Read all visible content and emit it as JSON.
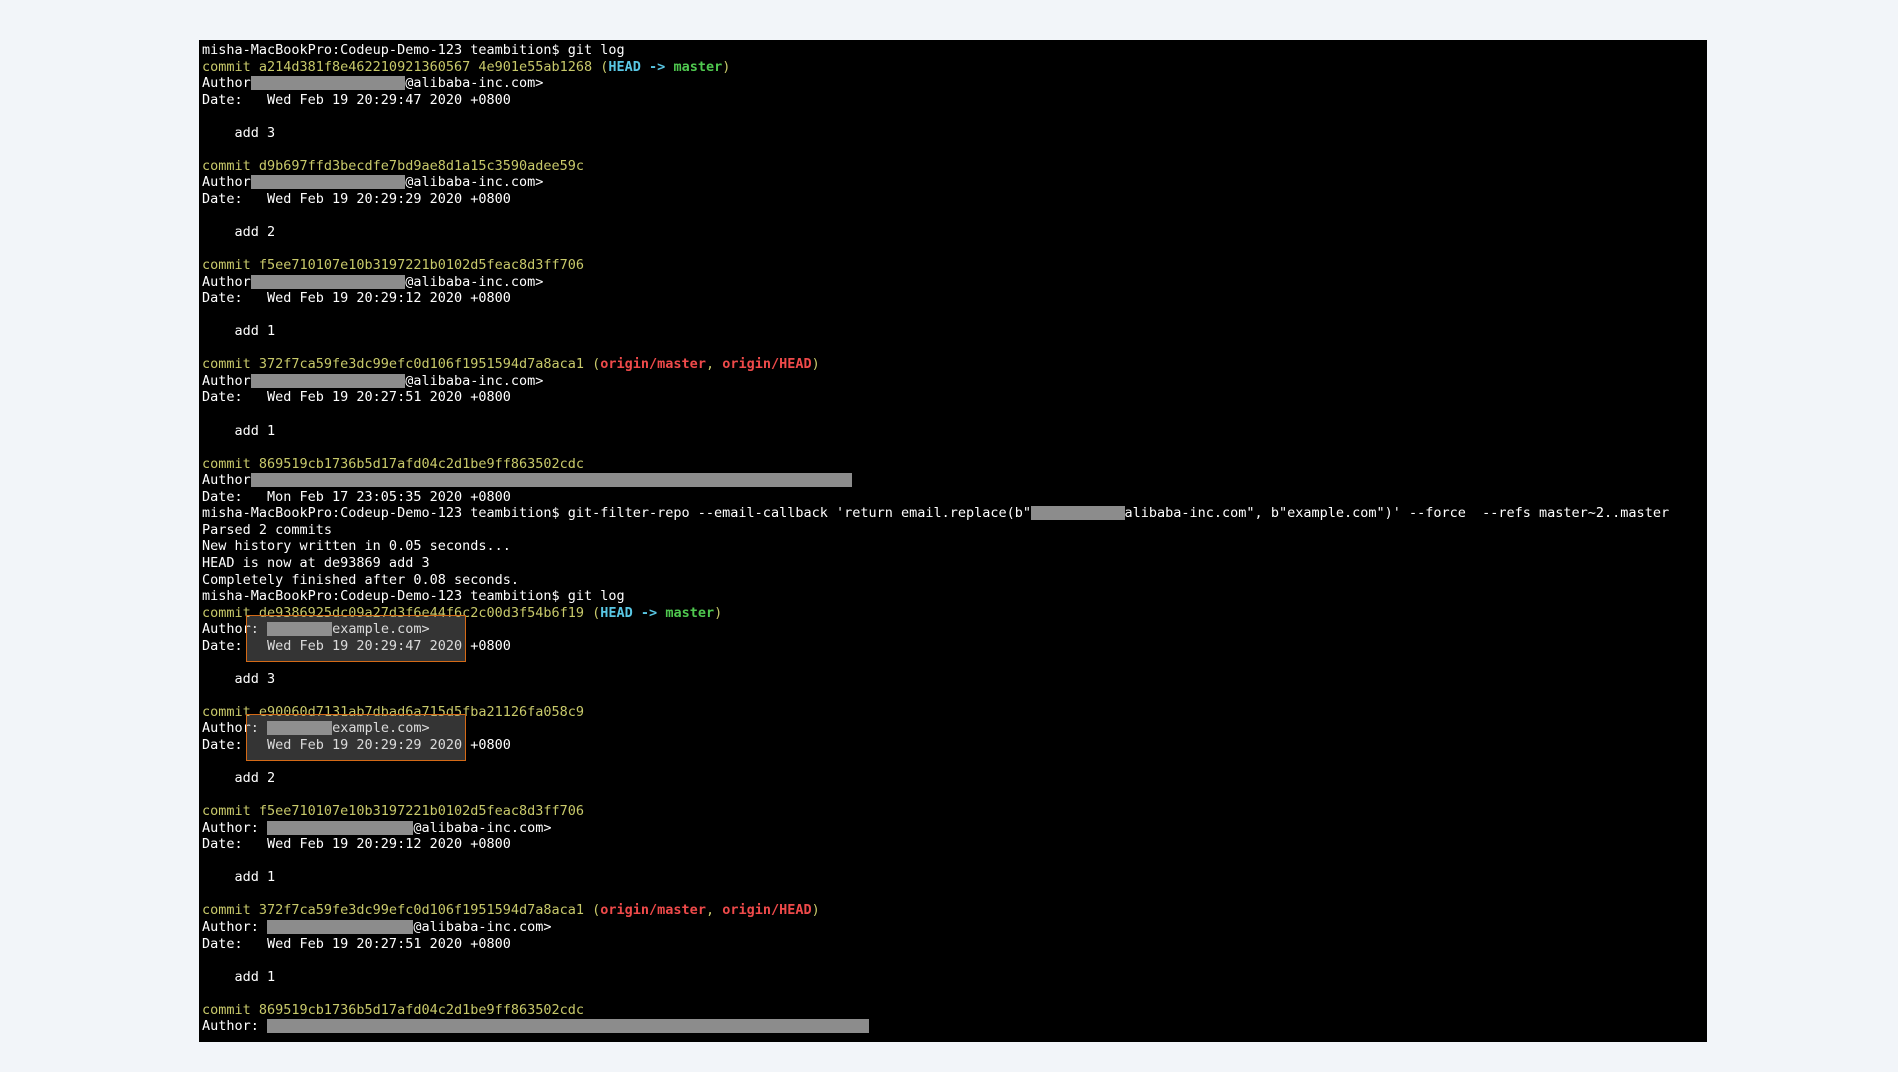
{
  "lines": [
    [
      {
        "t": "misha-MacBookPro:Codeup-Demo-123 teambition$ git log",
        "c": "white"
      }
    ],
    [
      {
        "t": "commit a214d381f8e462210921360567 4e901e55ab1268",
        "c": "yellow"
      },
      {
        "t": " (",
        "c": "yellow"
      },
      {
        "t": "HEAD",
        "c": "cyan"
      },
      {
        "t": " -> ",
        "c": "cyan"
      },
      {
        "t": "master",
        "c": "green"
      },
      {
        "t": ")",
        "c": "yellow"
      }
    ],
    [
      {
        "t": "Author",
        "c": "white"
      },
      {
        "r": 19
      },
      {
        "t": "@alibaba-inc.com>",
        "c": "white"
      }
    ],
    [
      {
        "t": "Date:   Wed Feb 19 20:29:47 2020 +0800",
        "c": "white"
      }
    ],
    [],
    [
      {
        "t": "    add 3",
        "c": "white"
      }
    ],
    [],
    [
      {
        "t": "commit d9b697ffd3becdfe7bd9ae8d1a15c3590adee59c",
        "c": "yellow"
      }
    ],
    [
      {
        "t": "Author",
        "c": "white"
      },
      {
        "r": 19
      },
      {
        "t": "@alibaba-inc.com>",
        "c": "white"
      }
    ],
    [
      {
        "t": "Date:   Wed Feb 19 20:29:29 2020 +0800",
        "c": "white"
      }
    ],
    [],
    [
      {
        "t": "    add 2",
        "c": "white"
      }
    ],
    [],
    [
      {
        "t": "commit f5ee710107e10b3197221b0102d5feac8d3ff706",
        "c": "yellow"
      }
    ],
    [
      {
        "t": "Author",
        "c": "white"
      },
      {
        "r": 19
      },
      {
        "t": "@alibaba-inc.com>",
        "c": "white"
      }
    ],
    [
      {
        "t": "Date:   Wed Feb 19 20:29:12 2020 +0800",
        "c": "white"
      }
    ],
    [],
    [
      {
        "t": "    add 1",
        "c": "white"
      }
    ],
    [],
    [
      {
        "t": "commit 372f7ca59fe3dc99efc0d106f1951594d7a8aca1",
        "c": "yellow"
      },
      {
        "t": " (",
        "c": "yellow"
      },
      {
        "t": "origin/master",
        "c": "red"
      },
      {
        "t": ", ",
        "c": "yellow"
      },
      {
        "t": "origin/HEAD",
        "c": "red"
      },
      {
        "t": ")",
        "c": "yellow"
      }
    ],
    [
      {
        "t": "Author",
        "c": "white"
      },
      {
        "r": 19
      },
      {
        "t": "@alibaba-inc.com>",
        "c": "white"
      }
    ],
    [
      {
        "t": "Date:   Wed Feb 19 20:27:51 2020 +0800",
        "c": "white"
      }
    ],
    [],
    [
      {
        "t": "    add 1",
        "c": "white"
      }
    ],
    [],
    [
      {
        "t": "commit 869519cb1736b5d17afd04c2d1be9ff863502cdc",
        "c": "yellow"
      }
    ],
    [
      {
        "t": "Author",
        "c": "white"
      },
      {
        "r": 74
      }
    ],
    [
      {
        "t": "Date:   Mon Feb 17 23:05:35 2020 +0800",
        "c": "white"
      }
    ],
    [
      {
        "t": "misha-MacBookPro:Codeup-Demo-123 teambition$ git-filter-repo --email-callback 'return email.replace(b\"",
        "c": "white"
      },
      {
        "r": 11.5
      },
      {
        "t": "alibaba-inc.com\", b\"example.com\")' --force  --refs master~2..master",
        "c": "white"
      }
    ],
    [
      {
        "t": "Parsed 2 commits",
        "c": "white"
      }
    ],
    [
      {
        "t": "New history written in 0.05 seconds...",
        "c": "white"
      }
    ],
    [
      {
        "t": "HEAD is now at de93869 add 3",
        "c": "white"
      }
    ],
    [
      {
        "t": "Completely finished after 0.08 seconds.",
        "c": "white"
      }
    ],
    [
      {
        "t": "misha-MacBookPro:Codeup-Demo-123 teambition$ git log",
        "c": "white"
      }
    ],
    [
      {
        "t": "commit de9386925dc09a27d3f6e44f6c2c00d3f54b6f19",
        "c": "yellow"
      },
      {
        "t": " (",
        "c": "yellow"
      },
      {
        "t": "HEAD",
        "c": "cyan"
      },
      {
        "t": " -> ",
        "c": "cyan"
      },
      {
        "t": "master",
        "c": "green"
      },
      {
        "t": ")",
        "c": "yellow"
      }
    ],
    [
      {
        "t": "Author: ",
        "c": "white"
      },
      {
        "r": 8
      },
      {
        "t": "example.com>",
        "c": "white"
      }
    ],
    [
      {
        "t": "Date:   Wed Feb 19 20:29:47 2020 +0800",
        "c": "white"
      }
    ],
    [],
    [
      {
        "t": "    add 3",
        "c": "white"
      }
    ],
    [],
    [
      {
        "t": "commit e90060d7131ab7dbad6a715d5fba21126fa058c9",
        "c": "yellow"
      }
    ],
    [
      {
        "t": "Author: ",
        "c": "white"
      },
      {
        "r": 8
      },
      {
        "t": "example.com>",
        "c": "white"
      }
    ],
    [
      {
        "t": "Date:   Wed Feb 19 20:29:29 2020 +0800",
        "c": "white"
      }
    ],
    [],
    [
      {
        "t": "    add 2",
        "c": "white"
      }
    ],
    [],
    [
      {
        "t": "commit f5ee710107e10b3197221b0102d5feac8d3ff706",
        "c": "yellow"
      }
    ],
    [
      {
        "t": "Author: ",
        "c": "white"
      },
      {
        "r": 18
      },
      {
        "t": "@alibaba-inc.com>",
        "c": "white"
      }
    ],
    [
      {
        "t": "Date:   Wed Feb 19 20:29:12 2020 +0800",
        "c": "white"
      }
    ],
    [],
    [
      {
        "t": "    add 1",
        "c": "white"
      }
    ],
    [],
    [
      {
        "t": "commit 372f7ca59fe3dc99efc0d106f1951594d7a8aca1",
        "c": "yellow"
      },
      {
        "t": " (",
        "c": "yellow"
      },
      {
        "t": "origin/master",
        "c": "red"
      },
      {
        "t": ", ",
        "c": "yellow"
      },
      {
        "t": "origin/HEAD",
        "c": "red"
      },
      {
        "t": ")",
        "c": "yellow"
      }
    ],
    [
      {
        "t": "Author: ",
        "c": "white"
      },
      {
        "r": 18
      },
      {
        "t": "@alibaba-inc.com>",
        "c": "white"
      }
    ],
    [
      {
        "t": "Date:   Wed Feb 19 20:27:51 2020 +0800",
        "c": "white"
      }
    ],
    [],
    [
      {
        "t": "    add 1",
        "c": "white"
      }
    ],
    [],
    [
      {
        "t": "commit 869519cb1736b5d17afd04c2d1be9ff863502cdc",
        "c": "yellow"
      }
    ],
    [
      {
        "t": "Author: ",
        "c": "white"
      },
      {
        "r": 74
      }
    ]
  ]
}
